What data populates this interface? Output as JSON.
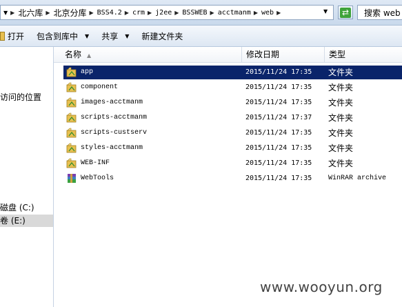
{
  "address_bar": {
    "crumbs": [
      {
        "label": "北六库",
        "cjk": true
      },
      {
        "label": "北京分库",
        "cjk": true
      },
      {
        "label": "BSS4.2",
        "cjk": false
      },
      {
        "label": "crm",
        "cjk": false
      },
      {
        "label": "j2ee",
        "cjk": false
      },
      {
        "label": "BSSWEB",
        "cjk": false
      },
      {
        "label": "acctmanm",
        "cjk": false
      },
      {
        "label": "web",
        "cjk": false
      }
    ]
  },
  "search": {
    "label": "搜索 web"
  },
  "toolbar": {
    "open_label": "打开",
    "include_label": "包含到库中",
    "share_label": "共享",
    "new_folder_label": "新建文件夹"
  },
  "nav": {
    "recent_label": "访问的位置",
    "drive_c_label": "磁盘 (C:)",
    "drive_e_label": "卷 (E:)"
  },
  "columns": {
    "name": "名称",
    "date": "修改日期",
    "type": "类型"
  },
  "files": [
    {
      "name": "app",
      "date": "2015/11/24 17:35",
      "type": "文件夹",
      "icon": "folder-icon"
    },
    {
      "name": "component",
      "date": "2015/11/24 17:35",
      "type": "文件夹",
      "icon": "folder-icon"
    },
    {
      "name": "images-acctmanm",
      "date": "2015/11/24 17:35",
      "type": "文件夹",
      "icon": "folder-icon"
    },
    {
      "name": "scripts-acctmanm",
      "date": "2015/11/24 17:37",
      "type": "文件夹",
      "icon": "folder-icon"
    },
    {
      "name": "scripts-custserv",
      "date": "2015/11/24 17:35",
      "type": "文件夹",
      "icon": "folder-icon"
    },
    {
      "name": "styles-acctmanm",
      "date": "2015/11/24 17:35",
      "type": "文件夹",
      "icon": "folder-icon"
    },
    {
      "name": "WEB-INF",
      "date": "2015/11/24 17:35",
      "type": "文件夹",
      "icon": "folder-icon"
    },
    {
      "name": "WebTools",
      "date": "2015/11/24 17:35",
      "type": "WinRAR archive",
      "icon": "winrar-archive-icon"
    }
  ],
  "selected_file_index": 0,
  "watermark": "www.wooyun.org",
  "colors": {
    "selection": "#0a246a",
    "folder": "#e8c050",
    "refresh": "#3fa33a"
  }
}
